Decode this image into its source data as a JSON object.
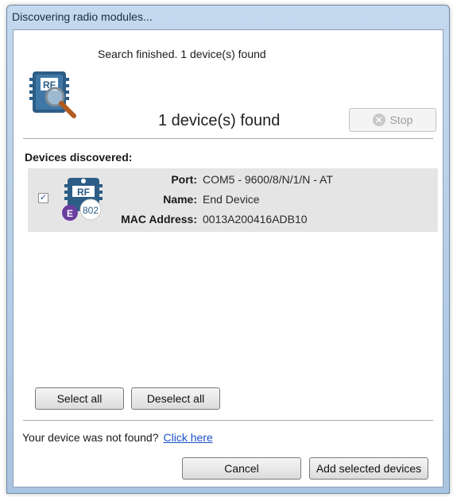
{
  "window": {
    "title": "Discovering radio modules..."
  },
  "search": {
    "status": "Search finished. 1 device(s) found",
    "found_count": "1 device(s) found",
    "stop_label": "Stop",
    "icon": "rf-module-search-icon"
  },
  "devices": {
    "section_label": "Devices discovered:",
    "items": [
      {
        "checked": true,
        "icon_text": "RF",
        "badge_letter": "E",
        "badge_number": "802",
        "port_label": "Port:",
        "port": "COM5 - 9600/8/N/1/N - AT",
        "name_label": "Name:",
        "name": "End Device",
        "mac_label": "MAC Address:",
        "mac": "0013A200416ADB10"
      }
    ]
  },
  "selection": {
    "select_all": "Select all",
    "deselect_all": "Deselect all"
  },
  "footer": {
    "not_found_text": "Your device was not found?",
    "click_here": "Click here",
    "cancel": "Cancel",
    "add_selected": "Add selected devices"
  },
  "colors": {
    "accent": "#1a4ec8",
    "row_bg": "#e5e5e5",
    "rf_blue": "#2c5d86",
    "badge_purple": "#6a3fa0"
  }
}
